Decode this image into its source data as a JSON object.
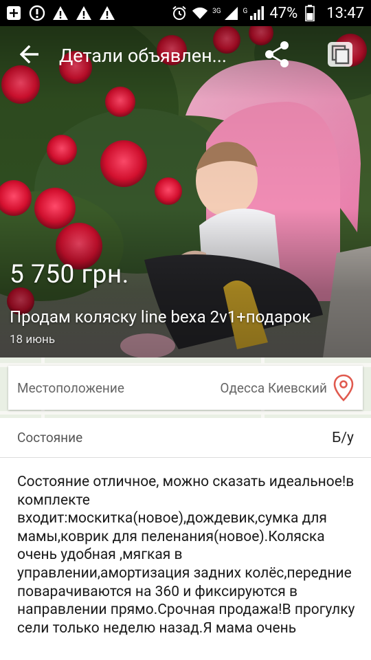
{
  "status_bar": {
    "battery_percent": "47%",
    "time": "13:47",
    "network_3g": "3G",
    "network_g": "G",
    "icons": [
      "add-box-icon",
      "alert-circle-icon",
      "warning-icon",
      "warning-icon",
      "warning-icon",
      "alarm-icon",
      "wifi-icon",
      "signal-icon",
      "signal-icon",
      "battery-icon"
    ]
  },
  "toolbar": {
    "title": "Детали объявлен...",
    "icons": [
      "back-arrow-icon",
      "share-icon",
      "copy-icon"
    ]
  },
  "listing": {
    "price": "5 750 грн.",
    "title": "Продам коляску line bexa 2v1+подарок",
    "date": "18  июнь"
  },
  "location": {
    "label": "Местоположение",
    "value": "Одесса Киевский",
    "pin_color": "#e05a4f"
  },
  "condition": {
    "label": "Состояние",
    "value": "Б/у"
  },
  "description": "Состояние отличное, можно сказать идеальное!в комплекте входит:москитка(новое),дождевик,сумка для мамы,коврик для пеленания(новое).Коляска очень удобная ,мягкая в управлении,амортизация задних колёс,передние поварачиваются на 360 и фиксируются в направлении прямо.Срочная продажа!В прогулку сели только неделю назад.Я мама очень"
}
